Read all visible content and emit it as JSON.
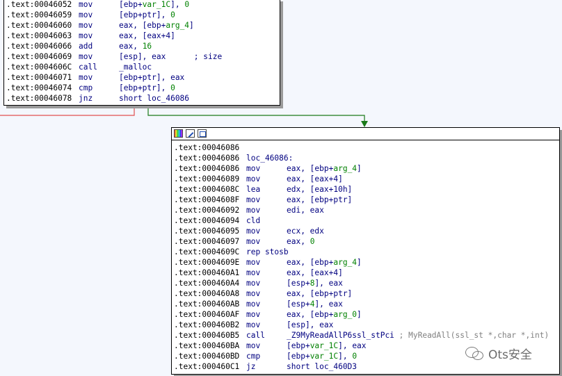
{
  "top_block": {
    "lines": [
      {
        "addr": ".text:00046052",
        "mn": "mov",
        "ops": [
          [
            "[ebp+",
            ""
          ],
          [
            "var_1C",
            "g"
          ],
          [
            "], ",
            ""
          ],
          [
            "0",
            "g"
          ]
        ]
      },
      {
        "addr": ".text:00046059",
        "mn": "mov",
        "ops": [
          [
            "[ebp+ptr], ",
            ""
          ],
          [
            "0",
            "g"
          ]
        ]
      },
      {
        "addr": ".text:00046060",
        "mn": "mov",
        "ops": [
          [
            "eax, [ebp+",
            ""
          ],
          [
            "arg_4",
            "g"
          ],
          [
            "]",
            ""
          ]
        ]
      },
      {
        "addr": ".text:00046063",
        "mn": "mov",
        "ops": [
          [
            "eax, [eax+4]",
            ""
          ]
        ]
      },
      {
        "addr": ".text:00046066",
        "mn": "add",
        "ops": [
          [
            "eax, ",
            ""
          ],
          [
            "16",
            "g"
          ]
        ]
      },
      {
        "addr": ".text:00046069",
        "mn": "mov",
        "ops": [
          [
            "[esp], eax      ; size",
            ""
          ]
        ]
      },
      {
        "addr": ".text:0004606C",
        "mn": "call",
        "ops": [
          [
            "_malloc",
            ""
          ]
        ]
      },
      {
        "addr": ".text:00046071",
        "mn": "mov",
        "ops": [
          [
            "[ebp+ptr], eax",
            ""
          ]
        ]
      },
      {
        "addr": ".text:00046074",
        "mn": "cmp",
        "ops": [
          [
            "[ebp+ptr], ",
            ""
          ],
          [
            "0",
            "g"
          ]
        ]
      },
      {
        "addr": ".text:00046078",
        "mn": "jnz",
        "ops": [
          [
            "short loc_46086",
            ""
          ]
        ]
      }
    ]
  },
  "bottom_block": {
    "lines": [
      {
        "addr": ".text:00046086",
        "mn": "",
        "ops": []
      },
      {
        "addr": ".text:00046086",
        "label": "loc_46086:"
      },
      {
        "addr": ".text:00046086",
        "mn": "mov",
        "ops": [
          [
            "eax, [ebp+",
            ""
          ],
          [
            "arg_4",
            "g"
          ],
          [
            "]",
            ""
          ]
        ]
      },
      {
        "addr": ".text:00046089",
        "mn": "mov",
        "ops": [
          [
            "eax, [eax+4]",
            ""
          ]
        ]
      },
      {
        "addr": ".text:0004608C",
        "mn": "lea",
        "ops": [
          [
            "edx, [eax+10h]",
            ""
          ]
        ]
      },
      {
        "addr": ".text:0004608F",
        "mn": "mov",
        "ops": [
          [
            "eax, [ebp+ptr]",
            ""
          ]
        ]
      },
      {
        "addr": ".text:00046092",
        "mn": "mov",
        "ops": [
          [
            "edi, eax",
            ""
          ]
        ]
      },
      {
        "addr": ".text:00046094",
        "mn": "cld",
        "ops": []
      },
      {
        "addr": ".text:00046095",
        "mn": "mov",
        "ops": [
          [
            "ecx, edx",
            ""
          ]
        ]
      },
      {
        "addr": ".text:00046097",
        "mn": "mov",
        "ops": [
          [
            "eax, ",
            ""
          ],
          [
            "0",
            "g"
          ]
        ]
      },
      {
        "addr": ".text:0004609C",
        "label": "rep stosb"
      },
      {
        "addr": ".text:0004609E",
        "mn": "mov",
        "ops": [
          [
            "eax, [ebp+",
            ""
          ],
          [
            "arg_4",
            "g"
          ],
          [
            "]",
            ""
          ]
        ]
      },
      {
        "addr": ".text:000460A1",
        "mn": "mov",
        "ops": [
          [
            "eax, [eax+4]",
            ""
          ]
        ]
      },
      {
        "addr": ".text:000460A4",
        "mn": "mov",
        "ops": [
          [
            "[esp+",
            ""
          ],
          [
            "8",
            "g"
          ],
          [
            "], eax",
            ""
          ]
        ]
      },
      {
        "addr": ".text:000460A8",
        "mn": "mov",
        "ops": [
          [
            "eax, [ebp+ptr]",
            ""
          ]
        ]
      },
      {
        "addr": ".text:000460AB",
        "mn": "mov",
        "ops": [
          [
            "[esp+",
            ""
          ],
          [
            "4",
            "g"
          ],
          [
            "], eax",
            ""
          ]
        ]
      },
      {
        "addr": ".text:000460AF",
        "mn": "mov",
        "ops": [
          [
            "eax, [ebp+",
            ""
          ],
          [
            "arg_0",
            "g"
          ],
          [
            "]",
            ""
          ]
        ]
      },
      {
        "addr": ".text:000460B2",
        "mn": "mov",
        "ops": [
          [
            "[esp], eax",
            ""
          ]
        ]
      },
      {
        "addr": ".text:000460B5",
        "mn": "call",
        "ops": [
          [
            "_Z9MyReadAllP6ssl_stPci",
            ""
          ],
          [
            " ; MyReadAll(ssl_st *,char *,int)",
            "c"
          ]
        ]
      },
      {
        "addr": ".text:000460BA",
        "mn": "mov",
        "ops": [
          [
            "[ebp+",
            ""
          ],
          [
            "var_1C",
            "g"
          ],
          [
            "], eax",
            ""
          ]
        ]
      },
      {
        "addr": ".text:000460BD",
        "mn": "cmp",
        "ops": [
          [
            "[ebp+",
            ""
          ],
          [
            "var_1C",
            "g"
          ],
          [
            "], ",
            ""
          ],
          [
            "0",
            "g"
          ]
        ]
      },
      {
        "addr": ".text:000460C1",
        "mn": "jz",
        "ops": [
          [
            "short loc_460D3",
            ""
          ]
        ]
      }
    ]
  },
  "titlebar_icons": [
    "color-palette-icon",
    "edit-pen-icon",
    "graph-view-icon"
  ],
  "watermark": {
    "text": "Ots安全",
    "icon": "wechat-icon"
  },
  "colors": {
    "background": "#f4f7fd",
    "text_navy": "#000080",
    "symbol_green": "#008000",
    "comment_gray": "#808080",
    "edge_true": "#1a7a1a",
    "edge_false": "#e05050"
  }
}
